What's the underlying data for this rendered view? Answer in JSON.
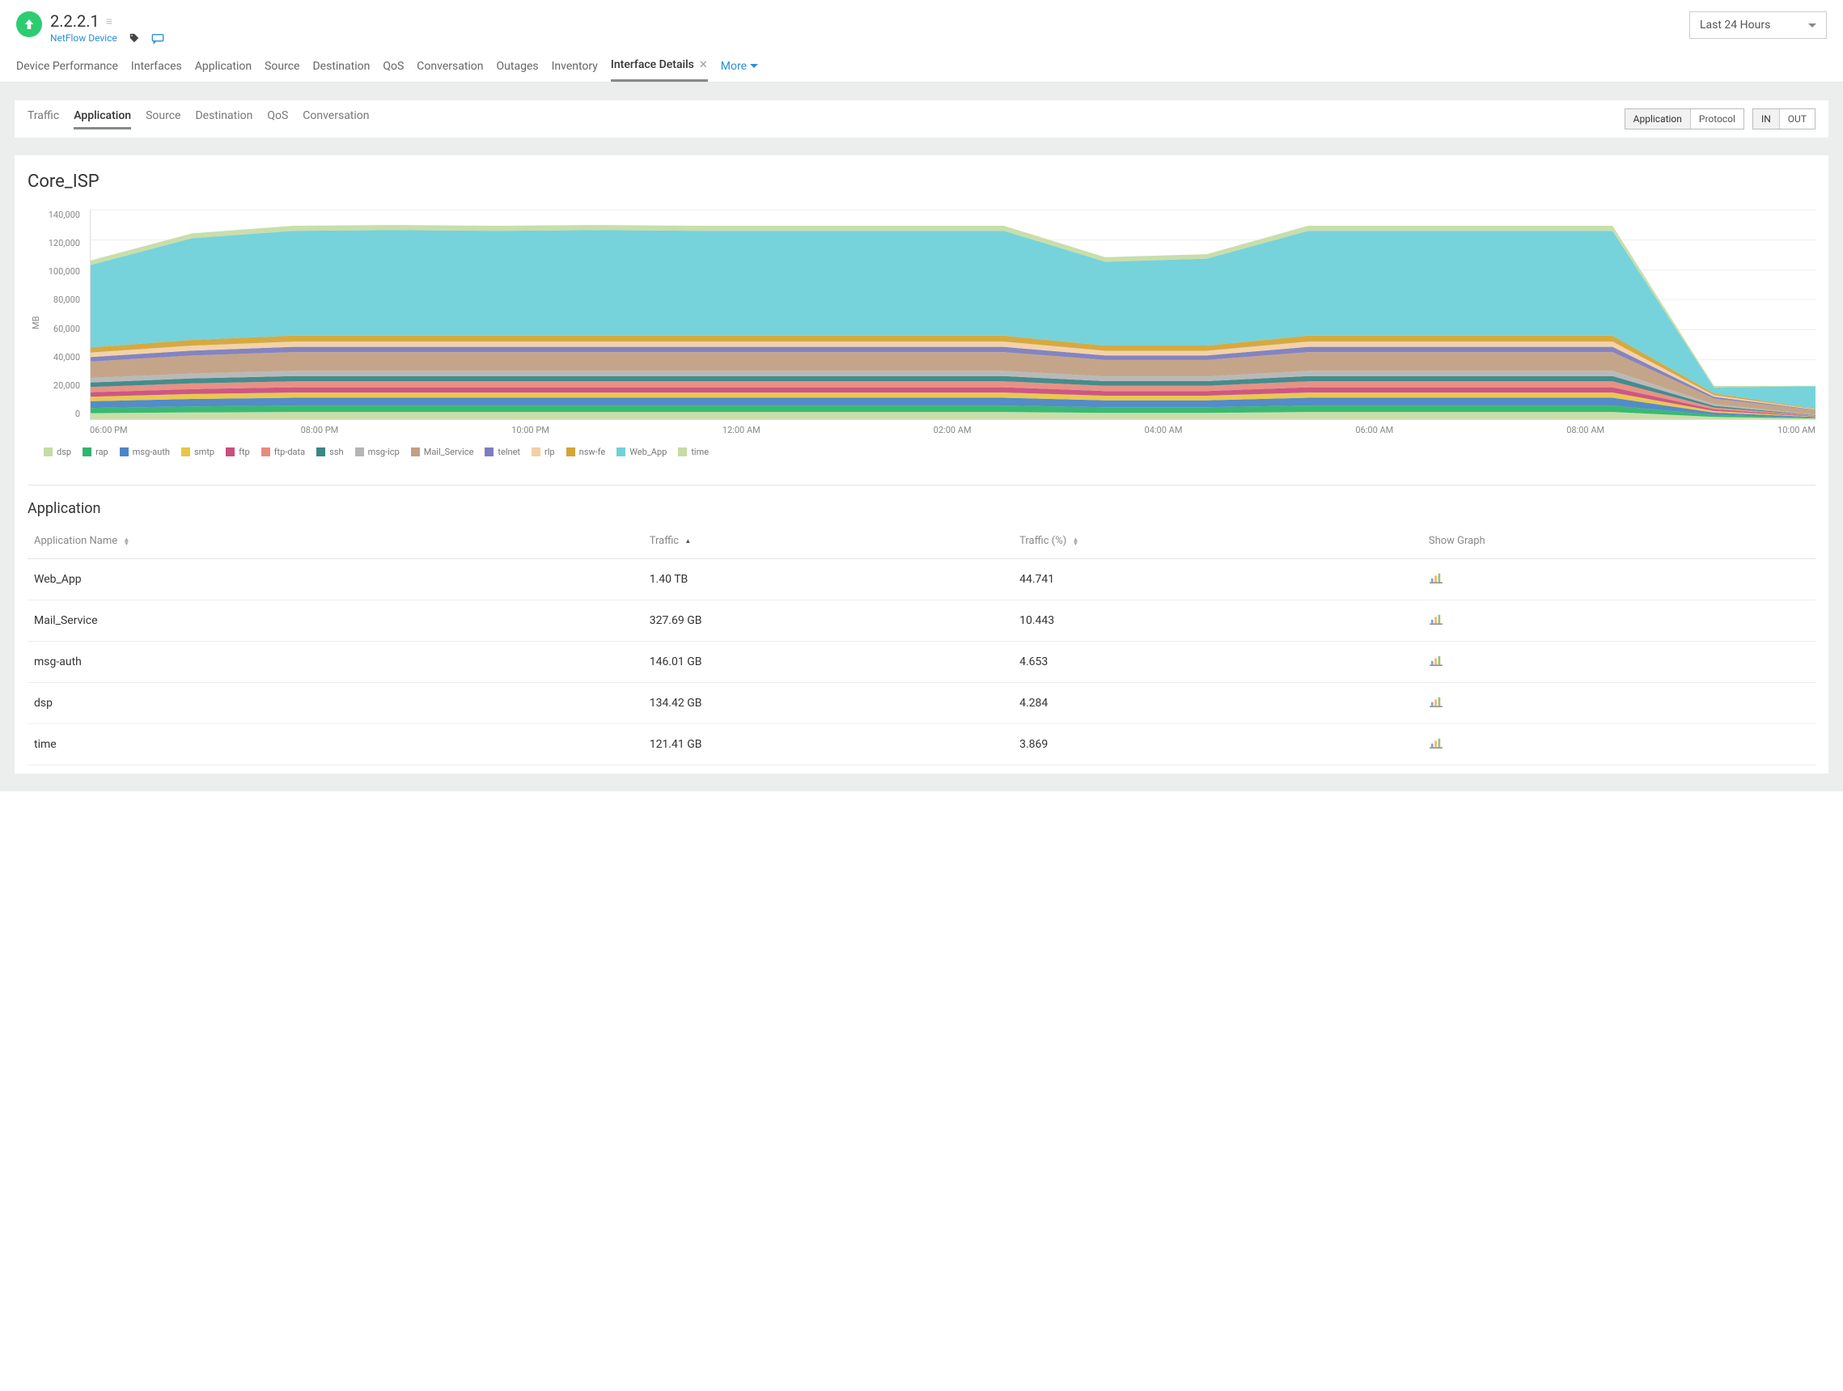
{
  "header": {
    "device_ip": "2.2.2.1",
    "subtitle_link": "NetFlow Device",
    "time_range": "Last 24 Hours"
  },
  "main_tabs": {
    "items": [
      "Device Performance",
      "Interfaces",
      "Application",
      "Source",
      "Destination",
      "QoS",
      "Conversation",
      "Outages",
      "Inventory"
    ],
    "active_label": "Interface Details",
    "more_label": "More"
  },
  "sub_tabs": {
    "items": [
      "Traffic",
      "Application",
      "Source",
      "Destination",
      "QoS",
      "Conversation"
    ],
    "active_index": 1,
    "seg1": {
      "a": "Application",
      "b": "Protocol"
    },
    "seg2": {
      "a": "IN",
      "b": "OUT"
    }
  },
  "section_title": "Core_ISP",
  "table": {
    "title": "Application",
    "headers": {
      "name": "Application Name",
      "traffic": "Traffic",
      "pct": "Traffic (%)",
      "show": "Show Graph"
    },
    "rows": [
      {
        "name": "Web_App",
        "traffic": "1.40 TB",
        "pct": "44.741"
      },
      {
        "name": "Mail_Service",
        "traffic": "327.69 GB",
        "pct": "10.443"
      },
      {
        "name": "msg-auth",
        "traffic": "146.01 GB",
        "pct": "4.653"
      },
      {
        "name": "dsp",
        "traffic": "134.42 GB",
        "pct": "4.284"
      },
      {
        "name": "time",
        "traffic": "121.41 GB",
        "pct": "3.869"
      }
    ]
  },
  "chart_data": {
    "type": "area",
    "stacked": true,
    "ylabel": "MB",
    "ylim": [
      0,
      140000
    ],
    "y_ticks": [
      "140,000",
      "120,000",
      "100,000",
      "80,000",
      "60,000",
      "40,000",
      "20,000",
      "0"
    ],
    "x_ticks": [
      "06:00 PM",
      "08:00 PM",
      "10:00 PM",
      "12:00 AM",
      "02:00 AM",
      "04:00 AM",
      "06:00 AM",
      "08:00 AM",
      "10:00 AM"
    ],
    "x": [
      0,
      1,
      2,
      3,
      4,
      5,
      6,
      7,
      8,
      9,
      10,
      11,
      12,
      13,
      14,
      15,
      16,
      17
    ],
    "series": [
      {
        "name": "dsp",
        "color": "#c6dca5",
        "values": [
          4000,
          4500,
          4800,
          4800,
          4800,
          4800,
          4800,
          4800,
          4800,
          4800,
          4200,
          4200,
          4800,
          4800,
          4800,
          4800,
          1500,
          500
        ]
      },
      {
        "name": "rap",
        "color": "#2fb56a",
        "values": [
          3500,
          4000,
          4300,
          4300,
          4300,
          4300,
          4300,
          4300,
          4300,
          4300,
          3800,
          3800,
          4300,
          4300,
          4300,
          4300,
          1300,
          400
        ]
      },
      {
        "name": "msg-auth",
        "color": "#4a86c5",
        "values": [
          4500,
          5000,
          5200,
          5200,
          5200,
          5200,
          5200,
          5200,
          5200,
          5200,
          4600,
          4600,
          5200,
          5200,
          5200,
          5200,
          1600,
          500
        ]
      },
      {
        "name": "smtp",
        "color": "#e8c547",
        "values": [
          3000,
          3300,
          3500,
          3500,
          3500,
          3500,
          3500,
          3500,
          3500,
          3500,
          3100,
          3100,
          3500,
          3500,
          3500,
          3500,
          1100,
          300
        ]
      },
      {
        "name": "ftp",
        "color": "#c94f7c",
        "values": [
          3000,
          3300,
          3500,
          3500,
          3500,
          3500,
          3500,
          3500,
          3500,
          3500,
          3100,
          3100,
          3500,
          3500,
          3500,
          3500,
          1100,
          300
        ]
      },
      {
        "name": "ftp-data",
        "color": "#e88b7d",
        "values": [
          3500,
          3800,
          4000,
          4000,
          4000,
          4000,
          4000,
          4000,
          4000,
          4000,
          3500,
          3500,
          4000,
          4000,
          4000,
          4000,
          1200,
          400
        ]
      },
      {
        "name": "ssh",
        "color": "#3b8686",
        "values": [
          3000,
          3300,
          3500,
          3500,
          3500,
          3500,
          3500,
          3500,
          3500,
          3500,
          3100,
          3100,
          3500,
          3500,
          3500,
          3500,
          1100,
          300
        ]
      },
      {
        "name": "msg-icp",
        "color": "#b5b5b5",
        "values": [
          3000,
          3300,
          3500,
          3500,
          3500,
          3500,
          3500,
          3500,
          3500,
          3500,
          3100,
          3100,
          3500,
          3500,
          3500,
          3500,
          1100,
          300
        ]
      },
      {
        "name": "Mail_Service",
        "color": "#c2a083",
        "values": [
          11000,
          12000,
          12500,
          12500,
          12500,
          12500,
          12500,
          12500,
          12500,
          12500,
          11000,
          11000,
          12500,
          12500,
          12500,
          12500,
          3800,
          3000
        ]
      },
      {
        "name": "telnet",
        "color": "#7d7dbf",
        "values": [
          3000,
          3300,
          3500,
          3500,
          3500,
          3500,
          3500,
          3500,
          3500,
          3500,
          3100,
          3100,
          3500,
          3500,
          3500,
          3500,
          1100,
          300
        ]
      },
      {
        "name": "rlp",
        "color": "#f2d0a4",
        "values": [
          3000,
          3300,
          3500,
          3500,
          3500,
          3500,
          3500,
          3500,
          3500,
          3500,
          3100,
          3100,
          3500,
          3500,
          3500,
          3500,
          1100,
          300
        ]
      },
      {
        "name": "nsw-fe",
        "color": "#d4a437",
        "values": [
          3500,
          3800,
          4000,
          4000,
          4000,
          4000,
          4000,
          4000,
          4000,
          4000,
          3500,
          3500,
          4000,
          4000,
          4000,
          4000,
          1200,
          400
        ]
      },
      {
        "name": "Web_App",
        "color": "#6fd1d9",
        "values": [
          55000,
          68000,
          70000,
          70500,
          70000,
          70500,
          70000,
          70000,
          70000,
          70000,
          56000,
          58000,
          70000,
          70000,
          70000,
          70000,
          4000,
          15000
        ]
      },
      {
        "name": "time",
        "color": "#c6dca5",
        "values": [
          3000,
          3200,
          3400,
          3400,
          3400,
          3400,
          3400,
          3400,
          3400,
          3400,
          3000,
          3000,
          3400,
          3400,
          3400,
          3400,
          1000,
          300
        ]
      }
    ]
  }
}
